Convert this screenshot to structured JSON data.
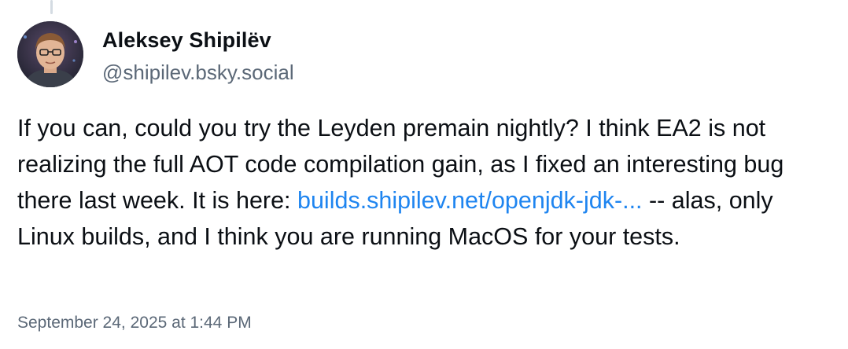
{
  "author": {
    "display_name": "Aleksey Shipilëv",
    "handle": "@shipilev.bsky.social"
  },
  "post": {
    "text_part1": "If you can, could you try the Leyden premain nightly? I think EA2 is not realizing the full AOT code compilation gain, as I fixed an interesting bug there last week. It is here: ",
    "link_text": "builds.shipilev.net/openjdk-jdk-...",
    "text_part2": " -- alas, only Linux builds, and I think you are running MacOS for your tests."
  },
  "timestamp": "September 24, 2025 at 1:44 PM",
  "colors": {
    "link": "#1f85f0",
    "secondary_text": "#5b6877",
    "primary_text": "#0b0f14"
  }
}
